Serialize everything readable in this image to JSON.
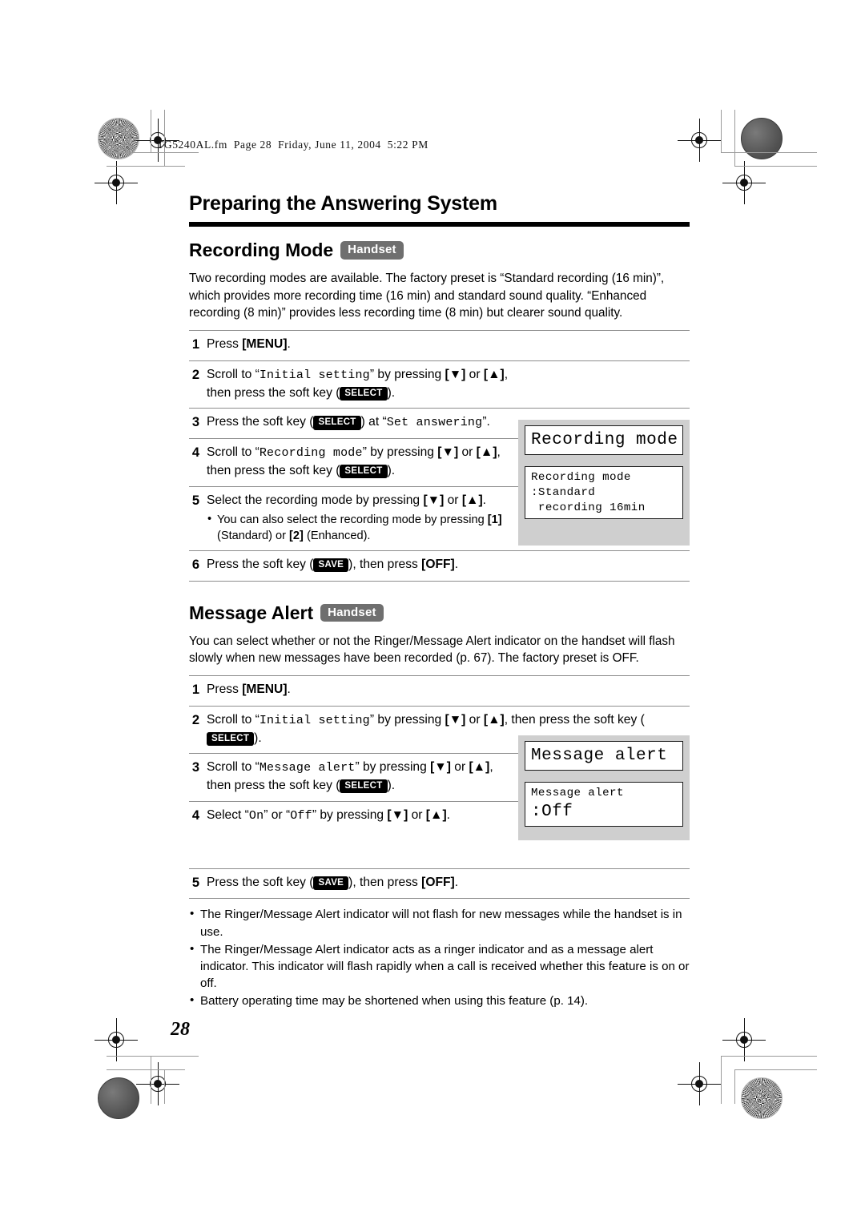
{
  "print_header": {
    "file_info": "TG5240AL.fm  Page 28  Friday, June 11, 2004  5:22 PM"
  },
  "chapter_title": "Preparing the Answering System",
  "page_number": "28",
  "sections": [
    {
      "heading": "Recording Mode",
      "badge": "Handset",
      "intro": "Two recording modes are available. The factory preset is “Standard recording (16 min)”, which provides more recording time (16 min) and standard sound quality. “Enhanced recording (8 min)” provides less recording time (8 min) but clearer sound quality.",
      "steps": [
        {
          "num": "1",
          "text_parts": [
            "Press ",
            "[MENU]",
            "."
          ]
        },
        {
          "num": "2",
          "text": "Scroll to “Initial setting” by pressing [▼] or [▲], then press the soft key (SELECT)."
        },
        {
          "num": "3",
          "text": "Press the soft key (SELECT) at “Set answering”."
        },
        {
          "num": "4",
          "text": "Scroll to “Recording mode” by pressing [▼] or [▲], then press the soft key (SELECT)."
        },
        {
          "num": "5",
          "text": "Select the recording mode by pressing [▼] or [▲].",
          "bullets": [
            "You can also select the recording mode by pressing [1] (Standard) or [2] (Enhanced)."
          ]
        },
        {
          "num": "6",
          "text": "Press the soft key (SAVE), then press [OFF]."
        }
      ],
      "lcd_panels": [
        {
          "kind": "big",
          "text": "Recording mode"
        },
        {
          "kind": "small",
          "lines": [
            "Recording mode",
            ":Standard",
            " recording 16min"
          ]
        }
      ]
    },
    {
      "heading": "Message Alert",
      "badge": "Handset",
      "intro": "You can select whether or not the Ringer/Message Alert indicator on the handset will flash slowly when new messages have been recorded (p. 67). The factory preset is OFF.",
      "steps": [
        {
          "num": "1",
          "text": "Press [MENU]."
        },
        {
          "num": "2",
          "text": "Scroll to “Initial setting” by pressing [▼] or [▲], then press the soft key (SELECT)."
        },
        {
          "num": "3",
          "text": "Scroll to “Message alert” by pressing [▼] or [▲], then press the soft key (SELECT)."
        },
        {
          "num": "4",
          "text": "Select “On” or “Off” by pressing [▼] or [▲]."
        },
        {
          "num": "5",
          "text": "Press the soft key (SAVE), then press [OFF]."
        }
      ],
      "lcd_panels": [
        {
          "kind": "big",
          "text": "Message alert"
        },
        {
          "kind": "mixed",
          "label": "Message alert",
          "value": ":Off"
        }
      ],
      "notes": [
        "The Ringer/Message Alert indicator will not flash for new messages while the handset is in use.",
        "The Ringer/Message Alert indicator acts as a ringer indicator and as a message alert indicator. This indicator will flash rapidly when a call is received whether this feature is on or off.",
        "Battery operating time may be shortened when using this feature (p. 14)."
      ]
    }
  ],
  "labels": {
    "softkey_select": "SELECT",
    "softkey_save": "SAVE",
    "key_menu": "MENU",
    "key_off": "OFF",
    "key_1": "1",
    "key_2": "2",
    "key_down": "▼",
    "key_up": "▲",
    "mono_initial_setting": "Initial setting",
    "mono_set_answering": "Set answering",
    "mono_recording_mode": "Recording mode",
    "mono_message_alert": "Message alert",
    "mono_on": "On",
    "mono_off": "Off",
    "lcd1_line1": "Recording mode",
    "lcd1_line2": ":Standard",
    "lcd1_line3": " recording 16min",
    "lcd2_label": "Message alert",
    "lcd2_value": ":Off"
  },
  "colors": {
    "badge_gray": "#6f6f6f",
    "lcd_frame_gray": "#cfcfcf",
    "rule_black": "#000000",
    "step_rule": "#8d8d8d"
  }
}
